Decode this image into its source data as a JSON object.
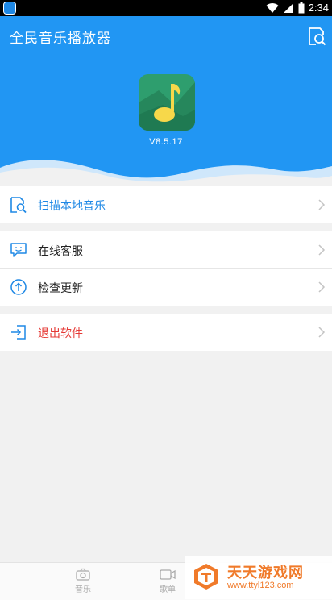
{
  "status_bar": {
    "time": "2:34"
  },
  "app_bar": {
    "title": "全民音乐播放器"
  },
  "hero": {
    "version": "V8.5.17"
  },
  "menu": [
    {
      "label": "扫描本地音乐",
      "icon": "scan-music-icon",
      "color": "#1e88e5"
    },
    {
      "label": "在线客服",
      "icon": "chat-service-icon"
    },
    {
      "label": "检查更新",
      "icon": "update-arrow-icon"
    },
    {
      "label": "退出软件",
      "icon": "exit-icon",
      "color": "#e53935"
    }
  ],
  "bottom_nav": {
    "tabs": [
      {
        "label": "音乐",
        "icon": "camera-icon"
      },
      {
        "label": "歌单",
        "icon": "video-icon"
      }
    ]
  },
  "watermark": {
    "title": "天天游戏网",
    "url": "www.ttyl123.com"
  },
  "colors": {
    "primary": "#2196f3",
    "background": "#f1f1f1"
  }
}
